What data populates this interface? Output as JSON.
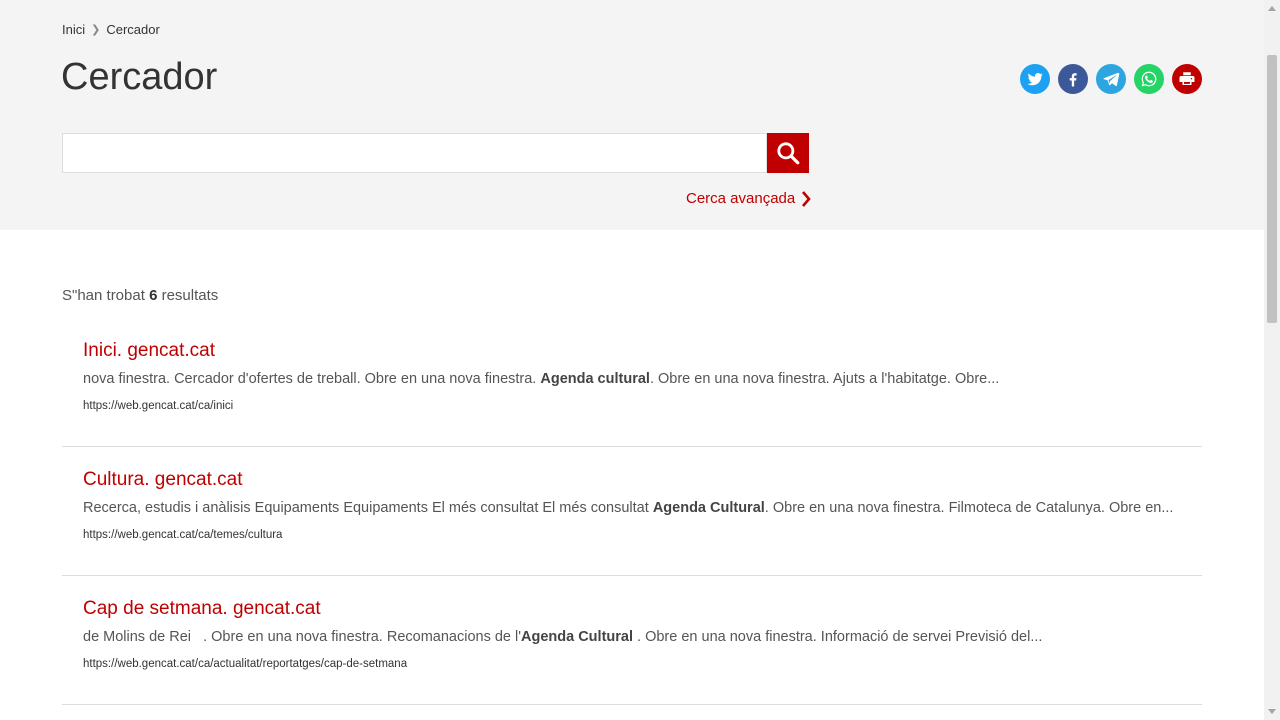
{
  "breadcrumb": {
    "home": "Inici",
    "current": "Cercador"
  },
  "page": {
    "title": "Cercador"
  },
  "share": {
    "items": [
      {
        "name": "twitter",
        "color": "#1da1f2"
      },
      {
        "name": "facebook",
        "color": "#3b5998"
      },
      {
        "name": "telegram",
        "color": "#2ca5e0"
      },
      {
        "name": "whatsapp",
        "color": "#25d366"
      },
      {
        "name": "print",
        "color": "#c00000"
      }
    ]
  },
  "search": {
    "value": "",
    "placeholder": "",
    "button_icon": "search-icon"
  },
  "advanced_search": {
    "label": "Cerca avançada",
    "icon": "chevron-right-icon"
  },
  "results_summary": {
    "prefix": "S\"han trobat",
    "count": "6",
    "suffix": "resultats"
  },
  "results": [
    {
      "title": "Inici. gencat.cat",
      "snippet_before": "nova finestra. Cercador d'ofertes de treball. Obre en una nova finestra. ",
      "snippet_bold": "Agenda cultural",
      "snippet_after": ". Obre en una nova finestra. Ajuts a l'habitatge. Obre...",
      "url": "https://web.gencat.cat/ca/inici"
    },
    {
      "title": "Cultura. gencat.cat",
      "snippet_before": "Recerca, estudis i anàlisis Equipaments Equipaments El més consultat El més consultat ",
      "snippet_bold": "Agenda Cultural",
      "snippet_after": ". Obre en una nova finestra. Filmoteca de Catalunya. Obre en...",
      "url": "https://web.gencat.cat/ca/temes/cultura"
    },
    {
      "title": "Cap de setmana. gencat.cat",
      "snippet_before": "de Molins de Rei   . Obre en una nova finestra. Recomanacions de l'",
      "snippet_bold": "Agenda Cultural",
      "snippet_after": " . Obre en una nova finestra. Informació de servei Previsió del...",
      "url": "https://web.gencat.cat/ca/actualitat/reportatges/cap-de-setmana"
    }
  ],
  "colors": {
    "accent": "#c00000",
    "header_bg": "#f4f4f4",
    "divider": "#dddddd"
  }
}
